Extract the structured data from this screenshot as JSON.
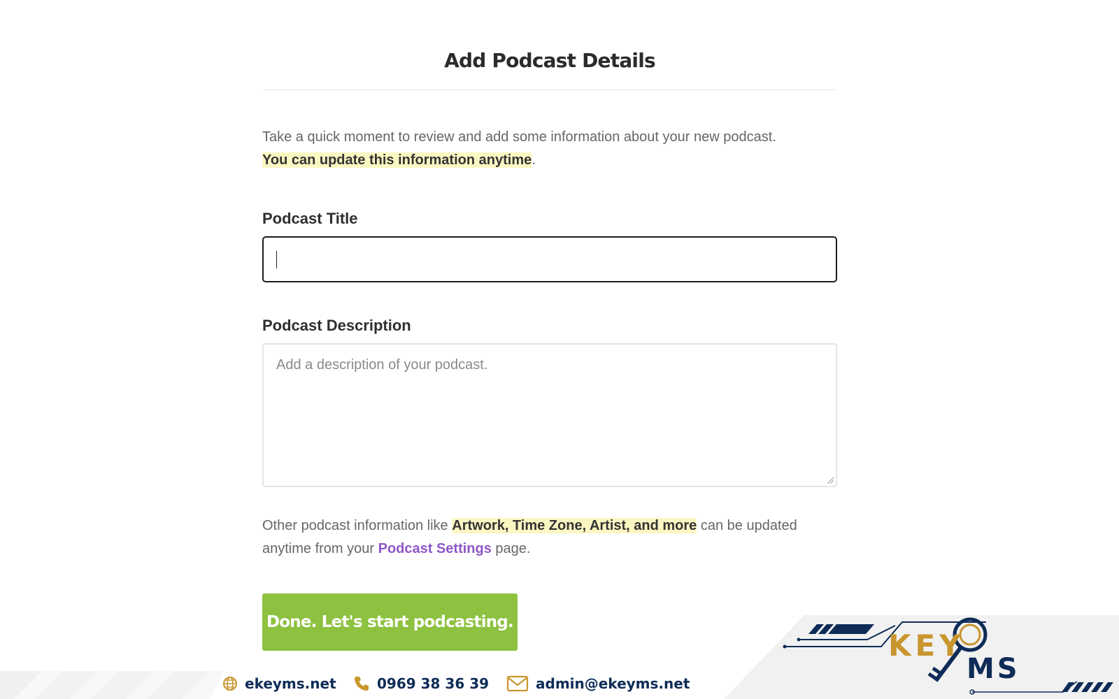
{
  "page": {
    "title": "Add Podcast Details",
    "intro_text": "Take a quick moment to review and add some information about your new podcast.",
    "intro_highlight": "You can update this information anytime",
    "intro_end": "."
  },
  "form": {
    "title_label": "Podcast Title",
    "title_value": "",
    "description_label": "Podcast Description",
    "description_placeholder": "Add a description of your podcast."
  },
  "other_info": {
    "prefix": "Other podcast information like ",
    "highlight": "Artwork, Time Zone, Artist, and more",
    "middle": " can be updated anytime from your ",
    "link": "Podcast Settings",
    "suffix": " page."
  },
  "actions": {
    "done_label": "Done. Let's start podcasting."
  },
  "footer": {
    "website": "ekeyms.net",
    "phone": "0969 38 36 39",
    "email": "admin@ekeyms.net",
    "brand_left": "KEY",
    "brand_right": "MS",
    "brand_color": "#c9952e",
    "navy": "#0e2c57",
    "accent": "#8dc13f",
    "link_color": "#8f57c6"
  }
}
